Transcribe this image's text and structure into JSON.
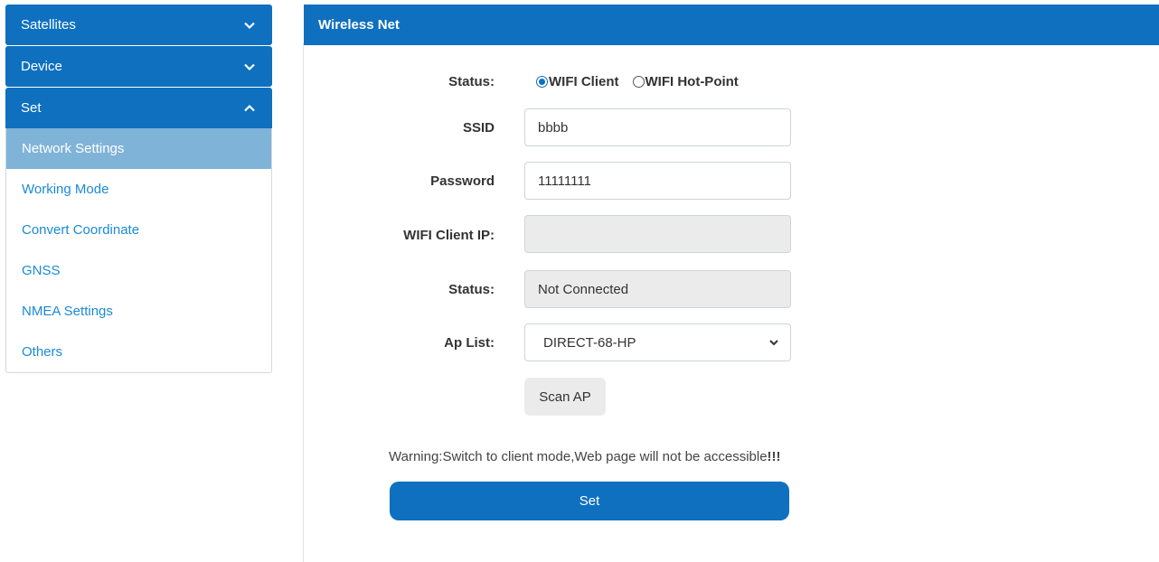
{
  "sidebar": {
    "sections": [
      {
        "label": "Satellites",
        "expanded": false
      },
      {
        "label": "Device",
        "expanded": false
      },
      {
        "label": "Set",
        "expanded": true
      }
    ],
    "items": [
      {
        "label": "Network Settings",
        "active": true
      },
      {
        "label": "Working Mode",
        "active": false
      },
      {
        "label": "Convert Coordinate",
        "active": false
      },
      {
        "label": "GNSS",
        "active": false
      },
      {
        "label": "NMEA Settings",
        "active": false
      },
      {
        "label": "Others",
        "active": false
      }
    ]
  },
  "panel": {
    "title": "Wireless Net",
    "mode": {
      "label": "Status:",
      "options": [
        "WIFI Client",
        "WIFI Hot-Point"
      ],
      "selected": "WIFI Client"
    },
    "ssid": {
      "label": "SSID",
      "value": "bbbb"
    },
    "password": {
      "label": "Password",
      "value": "11111111"
    },
    "client_ip": {
      "label": "WIFI Client IP:",
      "value": ""
    },
    "status": {
      "label": "Status:",
      "value": "Not Connected"
    },
    "ap_list": {
      "label": "Ap List:",
      "selected": "DIRECT-68-HP"
    },
    "scan_label": "Scan AP",
    "warning_text": "Warning:Switch to client mode,Web page will not be accessible",
    "warning_emphasis": "!!!",
    "set_label": "Set"
  },
  "colors": {
    "primary": "#0e70bf",
    "active_item": "#80b3d8",
    "link": "#1a8ad6",
    "readonly_bg": "#ebebeb"
  }
}
